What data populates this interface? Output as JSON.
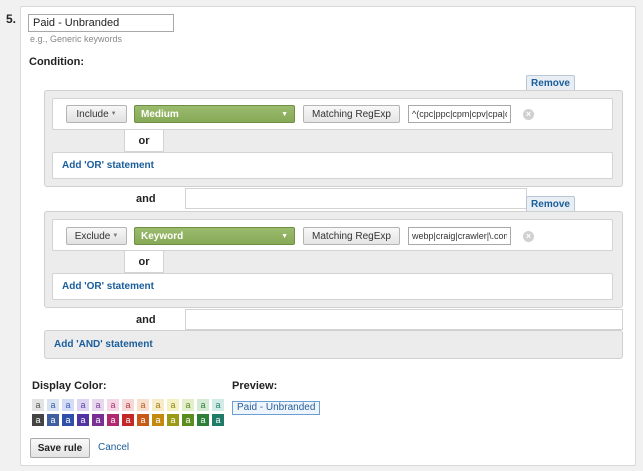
{
  "step": {
    "number": "5."
  },
  "rule_name": {
    "value": "Paid - Unbranded",
    "hint": "e.g., Generic keywords"
  },
  "condition": {
    "title": "Condition:",
    "remove_label": "Remove",
    "or_label": "or",
    "and_label": "and",
    "add_or_label": "Add 'OR' statement",
    "add_and_label": "Add 'AND' statement",
    "groups": [
      {
        "mode": "Include",
        "dimension": "Medium",
        "match_type": "Matching RegExp",
        "value": "^(cpc|ppc|cpm|cpv|cpa|cpp)$"
      },
      {
        "mode": "Exclude",
        "dimension": "Keyword",
        "match_type": "Matching RegExp",
        "value": "webp|craig|crawler|\\.com"
      }
    ]
  },
  "display_color": {
    "label": "Display Color:",
    "swatch_letter": "a",
    "light_colors": [
      "#e3e3e3",
      "#d7e2f2",
      "#d2dcf7",
      "#dcd4f2",
      "#e7d8ef",
      "#f4d6e6",
      "#f6d8d8",
      "#f8dfcd",
      "#f8ebc8",
      "#f4f2c2",
      "#e3efc9",
      "#d3ebd3",
      "#d1ece6"
    ],
    "light_text": [
      "#555555",
      "#3b5ba3",
      "#3c59b8",
      "#5a41a3",
      "#7a3c8f",
      "#a6336b",
      "#b33a3a",
      "#b35a1e",
      "#9c7a12",
      "#8a8320",
      "#5c8426",
      "#2f7a3a",
      "#2b7a69"
    ],
    "dark_colors": [
      "#444444",
      "#3f5f9e",
      "#2f4fa8",
      "#5133a1",
      "#7a2f95",
      "#b0286f",
      "#c32727",
      "#c65a16",
      "#c48a10",
      "#9a9a16",
      "#5a8d1d",
      "#2d7f38",
      "#1f7a66"
    ],
    "dark_text": "#ffffff"
  },
  "preview": {
    "label": "Preview:",
    "chip_text": "Paid - Unbranded"
  },
  "actions": {
    "save_label": "Save rule",
    "cancel_label": "Cancel"
  }
}
